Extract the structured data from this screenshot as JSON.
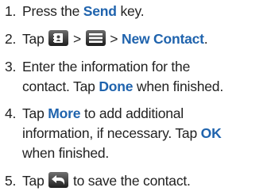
{
  "steps": [
    {
      "number": "1.",
      "lines": [
        {
          "parts": [
            {
              "text": "Press the "
            },
            {
              "text": "Send",
              "kw": true
            },
            {
              "text": " key."
            }
          ]
        }
      ]
    },
    {
      "number": "2.",
      "lines": [
        {
          "parts": [
            {
              "text": "Tap "
            },
            {
              "icon": "contacts-icon"
            },
            {
              "text": " > "
            },
            {
              "icon": "menu-icon"
            },
            {
              "text": " > "
            },
            {
              "text": "New Contact",
              "kw": true
            },
            {
              "text": "."
            }
          ]
        }
      ]
    },
    {
      "number": "3.",
      "lines": [
        {
          "parts": [
            {
              "text": "Enter the information for the"
            }
          ]
        },
        {
          "parts": [
            {
              "text": "contact. Tap "
            },
            {
              "text": "Done",
              "kw": true
            },
            {
              "text": " when finished."
            }
          ]
        }
      ]
    },
    {
      "number": "4.",
      "lines": [
        {
          "parts": [
            {
              "text": "Tap "
            },
            {
              "text": "More",
              "kw": true
            },
            {
              "text": " to add additional"
            }
          ]
        },
        {
          "parts": [
            {
              "text": "information, if necessary. Tap "
            },
            {
              "text": "OK",
              "kw": true
            }
          ]
        },
        {
          "parts": [
            {
              "text": "when finished."
            }
          ]
        }
      ]
    },
    {
      "number": "5.",
      "lines": [
        {
          "parts": [
            {
              "text": "Tap "
            },
            {
              "icon": "back-arrow-icon"
            },
            {
              "text": " to save the contact."
            }
          ]
        }
      ]
    }
  ],
  "colors": {
    "keyword": "#1f63ad",
    "text": "#222222"
  }
}
